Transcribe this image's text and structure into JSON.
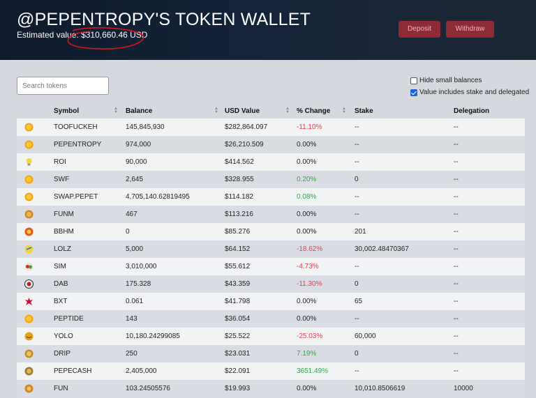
{
  "header": {
    "title": "@PEPENTROPY'S TOKEN WALLET",
    "estimate_label": "Estimated value:",
    "estimate_value": "$310,660.46 USD",
    "deposit_label": "Deposit",
    "withdraw_label": "Withdraw",
    "button_color": "#8f2b37"
  },
  "search": {
    "placeholder": "Search tokens",
    "value": ""
  },
  "options": {
    "hide_small": {
      "label": "Hide small balances",
      "checked": false
    },
    "include_stake": {
      "label": "Value includes stake and delegated",
      "checked": true
    }
  },
  "table": {
    "columns": [
      "Symbol",
      "Balance",
      "USD Value",
      "% Change",
      "Stake",
      "Delegation"
    ],
    "rows": [
      {
        "icon": "coin-icon",
        "symbol": "TOOFUCKEH",
        "balance": "145,845,930",
        "usd": "$282,864.097",
        "change": "-11.10%",
        "stake": "--",
        "delegation": "--"
      },
      {
        "icon": "coin-icon",
        "symbol": "PEPENTROPY",
        "balance": "974,000",
        "usd": "$26,210.509",
        "change": "0.00%",
        "stake": "--",
        "delegation": "--"
      },
      {
        "icon": "lightbulb-icon",
        "symbol": "ROI",
        "balance": "90,000",
        "usd": "$414.562",
        "change": "0.00%",
        "stake": "--",
        "delegation": "--"
      },
      {
        "icon": "coin-icon",
        "symbol": "SWF",
        "balance": "2,645",
        "usd": "$328.955",
        "change": "0.20%",
        "stake": "0",
        "delegation": "--"
      },
      {
        "icon": "coin-icon",
        "symbol": "SWAP.PEPET",
        "balance": "4,705,140.62819495",
        "usd": "$114.182",
        "change": "0.08%",
        "stake": "--",
        "delegation": "--"
      },
      {
        "icon": "funm-icon",
        "symbol": "FUNM",
        "balance": "467",
        "usd": "$113.216",
        "change": "0.00%",
        "stake": "--",
        "delegation": "--"
      },
      {
        "icon": "bbhm-icon",
        "symbol": "BBHM",
        "balance": "0",
        "usd": "$85.276",
        "change": "0.00%",
        "stake": "201",
        "delegation": "--"
      },
      {
        "icon": "lolz-icon",
        "symbol": "LOLZ",
        "balance": "5,000",
        "usd": "$64.152",
        "change": "-18.62%",
        "stake": "30,002.48470367",
        "delegation": "--"
      },
      {
        "icon": "sim-icon",
        "symbol": "SIM",
        "balance": "3,010,000",
        "usd": "$55.612",
        "change": "-4.73%",
        "stake": "--",
        "delegation": "--"
      },
      {
        "icon": "dab-icon",
        "symbol": "DAB",
        "balance": "175.328",
        "usd": "$43.359",
        "change": "-11.30%",
        "stake": "0",
        "delegation": "--"
      },
      {
        "icon": "bxt-icon",
        "symbol": "BXT",
        "balance": "0.061",
        "usd": "$41.798",
        "change": "0.00%",
        "stake": "65",
        "delegation": "--"
      },
      {
        "icon": "coin-icon",
        "symbol": "PEPTIDE",
        "balance": "143",
        "usd": "$36.054",
        "change": "0.00%",
        "stake": "--",
        "delegation": "--"
      },
      {
        "icon": "yolo-icon",
        "symbol": "YOLO",
        "balance": "10,180.24299085",
        "usd": "$25.522",
        "change": "-25.03%",
        "stake": "60,000",
        "delegation": "--"
      },
      {
        "icon": "drip-icon",
        "symbol": "DRIP",
        "balance": "250",
        "usd": "$23.031",
        "change": "7.19%",
        "stake": "0",
        "delegation": "--"
      },
      {
        "icon": "pepecash-icon",
        "symbol": "PEPECASH",
        "balance": "2,405,000",
        "usd": "$22.091",
        "change": "3651.49%",
        "stake": "--",
        "delegation": "--"
      },
      {
        "icon": "fun-icon",
        "symbol": "FUN",
        "balance": "103.24505576",
        "usd": "$19.993",
        "change": "0.00%",
        "stake": "10,010.8506619",
        "delegation": "10000"
      }
    ]
  },
  "colors": {
    "negative": "#e0404a",
    "positive": "#2fa84a",
    "header_bg": "#14233a"
  }
}
